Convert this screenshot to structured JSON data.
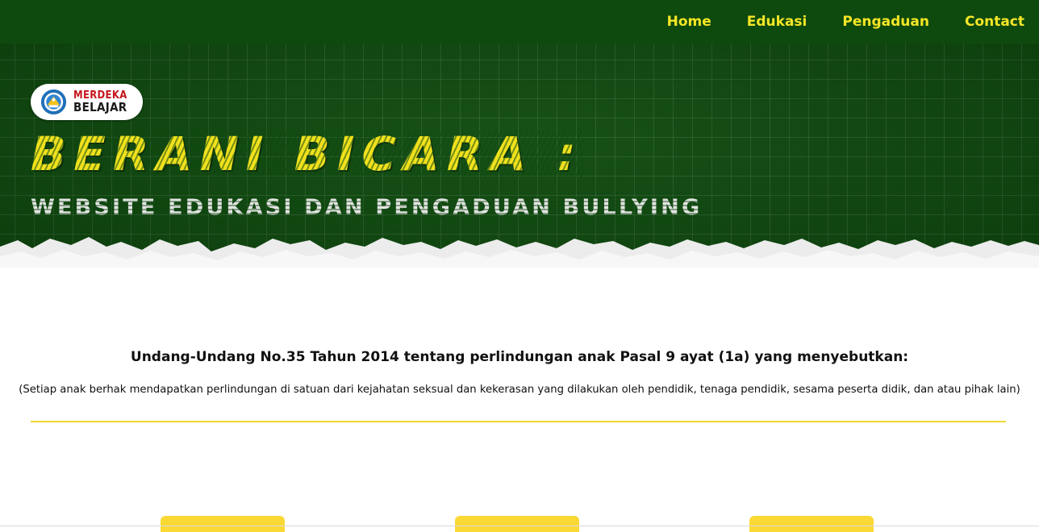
{
  "nav": {
    "items": [
      {
        "label": "Home"
      },
      {
        "label": "Edukasi"
      },
      {
        "label": "Pengaduan"
      },
      {
        "label": "Contact"
      }
    ]
  },
  "hero": {
    "badge": {
      "line1": "MERDEKA",
      "line2": "BELAJAR"
    },
    "title": "BERANI BICARA :",
    "subtitle": "WEBSITE EDUKASI DAN PENGADUAN BULLYING"
  },
  "content": {
    "heading": "Undang-Undang No.35 Tahun 2014 tentang perlindungan anak Pasal 9 ayat (1a) yang menyebutkan:",
    "quote": "(Setiap anak berhak mendapatkan perlindungan di satuan dari kejahatan seksual dan kekerasan yang dilakukan oleh pendidik, tenaga pendidik, sesama peserta didik, dan atau pihak lain)"
  },
  "colors": {
    "dark_green": "#0e4a0e",
    "accent_yellow": "#f5e625",
    "divider_yellow": "#f2d633",
    "card_yellow": "#fbd935"
  }
}
